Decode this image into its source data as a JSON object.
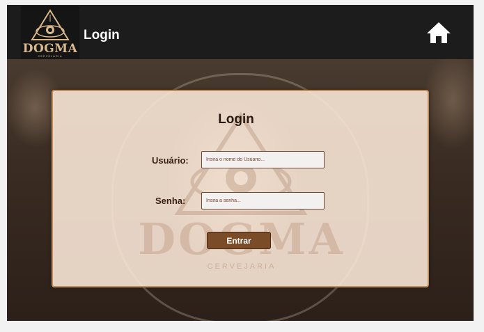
{
  "header": {
    "title": "Login",
    "logo_text": "DOGMA",
    "logo_subtext": "CERVEJARIA",
    "home_icon": "home-icon"
  },
  "login": {
    "title": "Login",
    "username_label": "Usuário:",
    "username_placeholder": "Insira o nome do Usúario...",
    "password_label": "Senha:",
    "password_placeholder": "Insira a senha...",
    "submit_label": "Entrar"
  },
  "colors": {
    "header_bg": "#1c1c1c",
    "accent_brown": "#7a4c28",
    "panel_border": "#c08e5b",
    "logo_gold": "#d9b98c"
  }
}
